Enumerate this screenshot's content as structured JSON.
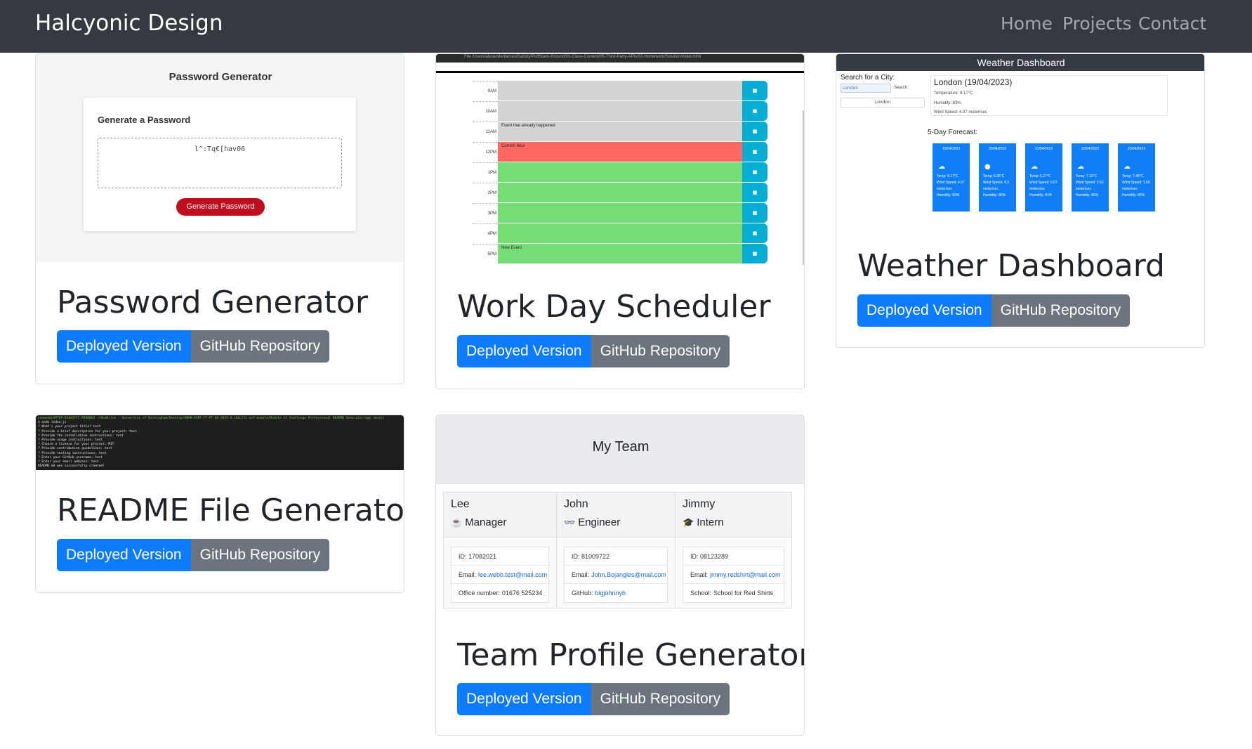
{
  "navbar": {
    "brand": "Halcyonic Design",
    "links": [
      "Home",
      "Projects",
      "Contact"
    ]
  },
  "common": {
    "deployed_label": "Deployed Version",
    "github_label": "GitHub Repository"
  },
  "projects": [
    {
      "title": "Password Generator",
      "screenshot": {
        "heading": "Password Generator",
        "subheading": "Generate a Password",
        "password_value": "l^:Tq€[hav06",
        "button": "Generate Password"
      }
    },
    {
      "title": "Work Day Scheduler",
      "screenshot": {
        "path_text": "File  /Users/alexanderbarras/Gatsby/PullStack-Ground/01-Class-Content/05-Third-Party-APIs/02-Homework/Solution/index.html",
        "hours": [
          "9AM",
          "10AM",
          "11AM",
          "12PM",
          "1PM",
          "2PM",
          "3PM",
          "4PM",
          "5PM"
        ],
        "events": [
          "",
          "",
          "Event that already happened",
          "Current hour",
          "",
          "",
          "",
          "",
          "New Event"
        ],
        "states": [
          "past",
          "past",
          "past",
          "present",
          "future",
          "future",
          "future",
          "future",
          "future"
        ]
      }
    },
    {
      "title": "Weather Dashboard",
      "screenshot": {
        "header": "Weather Dashboard",
        "search_label": "Search for a City:",
        "search_value": "London",
        "search_button": "Search",
        "history_item": "London",
        "current_title": "London (19/04/2023)",
        "current_temp": "Temperature: 9.17°C",
        "current_humidity": "Humidity: 83%",
        "current_wind": "Wind Speed: 4.07 meter/sec",
        "forecast_label": "5-Day Forecast:",
        "forecast": [
          {
            "date": "19/04/2023",
            "icon": "☁",
            "temp": "Temp: 9.17°C",
            "wind": "Wind Speed: 4.07 meter/sec",
            "humidity": "Humidity: 83%"
          },
          {
            "date": "20/04/2023",
            "icon": "●",
            "temp": "Temp: 6.36°C",
            "wind": "Wind Speed: 4.3 meter/sec",
            "humidity": "Humidity: 80%"
          },
          {
            "date": "21/04/2023",
            "icon": "☁",
            "temp": "Temp: 6.27°C",
            "wind": "Wind Speed: 6.07 meter/sec",
            "humidity": "Humidity: 81%"
          },
          {
            "date": "22/04/2023",
            "icon": "☁",
            "temp": "Temp: 7.11°C",
            "wind": "Wind Speed: 2.52 meter/sec",
            "humidity": "Humidity: 85%"
          },
          {
            "date": "23/04/2023",
            "icon": "☁",
            "temp": "Temp: 7.48°C",
            "wind": "Wind Speed: 1.68 meter/sec",
            "humidity": "Humidity: 85%"
          }
        ]
      }
    },
    {
      "title": "README File Generator",
      "screenshot": {
        "lines": [
          "LeeweebLAPTOP-Q18A2FIC MINGW64 ~/OneDrive - University of Birmingham/Desktop/UBHM-VIRT-FT-PT-02-2023-U-LOLC/11-ecf-module/Module 11 Challenge Professional README Generator/app (main)",
          "$ node index.js",
          "? What's your project title? test",
          "? Provide a brief description for your project: test",
          "? Provide the installation instructions: test",
          "? Provide usage instructions: test",
          "? Choose a license for your project: MIT",
          "? Provide contribution guidelines: test",
          "? Provide testing instructions: test",
          "? Enter your GitHub username: test",
          "? Enter your email address: test",
          "README.md was successfully created!"
        ]
      }
    },
    {
      "title": "Team Profile Generator",
      "screenshot": {
        "heading": "My Team",
        "members": [
          {
            "name": "Lee",
            "role_icon": "☕",
            "role": "Manager",
            "id": "ID: 17082021",
            "email_label": "Email:",
            "email": "lee.webb.test@mail.com",
            "extra_label": "Office number:",
            "extra": "01676 525234"
          },
          {
            "name": "John",
            "role_icon": "👓",
            "role": "Engineer",
            "id": "ID: 81009722",
            "email_label": "Email:",
            "email": "John.Bojangles@mail.com",
            "extra_label": "GitHub:",
            "extra": "bigjohnnyb"
          },
          {
            "name": "Jimmy",
            "role_icon": "🎓",
            "role": "Intern",
            "id": "ID: 08123289",
            "email_label": "Email:",
            "email": "jimmy.redshirt@mail.com",
            "extra_label": "School:",
            "extra": "School for Red Shirts"
          }
        ]
      }
    }
  ]
}
